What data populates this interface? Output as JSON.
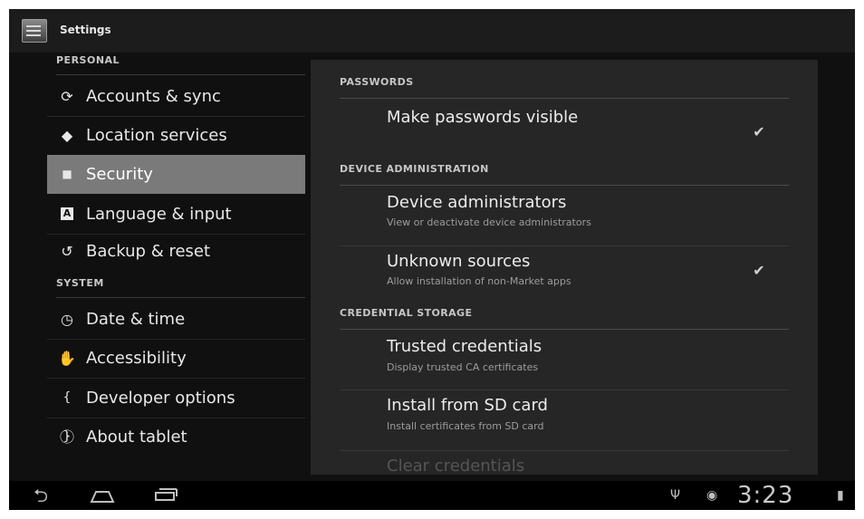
{
  "colors": {
    "background": "#101010",
    "selected_item": "#7a7a7a",
    "detail_panel": "#262626",
    "text_primary": "#ececec",
    "text_secondary": "#9c9c9c"
  },
  "actionbar": {
    "app_icon": "settings-icon",
    "title": "Settings"
  },
  "sidebar": {
    "personal_header": "PERSONAL",
    "personal_items": [
      {
        "icon": "sync-icon",
        "glyph": "⟳",
        "label": "Accounts & sync"
      },
      {
        "icon": "location-icon",
        "glyph": "◆",
        "label": "Location services"
      },
      {
        "icon": "lock-icon",
        "glyph": "■",
        "label": "Security",
        "selected": true
      },
      {
        "icon": "language-icon",
        "glyph": "A",
        "label": "Language & input"
      },
      {
        "icon": "backup-icon",
        "glyph": "↺",
        "label": "Backup & reset"
      }
    ],
    "system_header": "SYSTEM",
    "system_items": [
      {
        "icon": "clock-icon",
        "glyph": "◷",
        "label": "Date & time"
      },
      {
        "icon": "hand-icon",
        "glyph": "✋",
        "label": "Accessibility"
      },
      {
        "icon": "braces-icon",
        "glyph": "{ }",
        "label": "Developer options"
      },
      {
        "icon": "info-icon",
        "glyph": "ⓘ",
        "label": "About tablet"
      }
    ]
  },
  "detail": {
    "passwords": {
      "header": "PASSWORDS",
      "make_visible": {
        "title": "Make passwords visible",
        "checked": true
      }
    },
    "device_admin": {
      "header": "DEVICE ADMINISTRATION",
      "administrators": {
        "title": "Device administrators",
        "summary": "View or deactivate device administrators"
      },
      "unknown_sources": {
        "title": "Unknown sources",
        "summary": "Allow installation of non-Market apps",
        "checked": true
      }
    },
    "credential_storage": {
      "header": "CREDENTIAL STORAGE",
      "trusted": {
        "title": "Trusted credentials",
        "summary": "Display trusted CA certificates"
      },
      "install_sd": {
        "title": "Install from SD card",
        "summary": "Install certificates from SD card"
      },
      "clear": {
        "title": "Clear credentials",
        "enabled": false
      }
    }
  },
  "systembar": {
    "back_icon": "back-icon",
    "home_icon": "home-icon",
    "recents_icon": "recents-icon",
    "usb_icon": "usb-icon",
    "android_icon": "android-icon",
    "clock": "3:23",
    "battery_icon": "battery-icon"
  }
}
